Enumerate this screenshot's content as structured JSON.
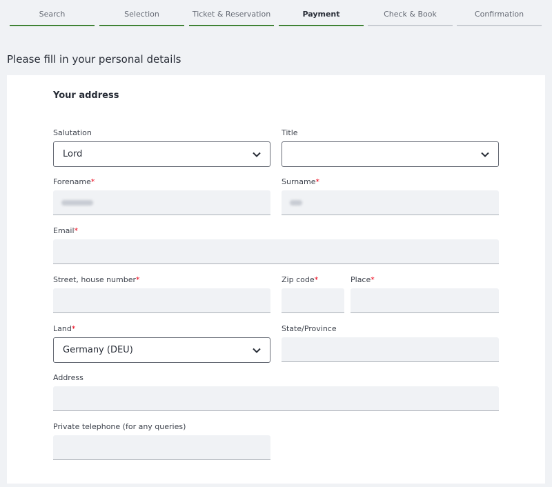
{
  "steps": [
    {
      "label": "Search",
      "state": "done"
    },
    {
      "label": "Selection",
      "state": "done"
    },
    {
      "label": "Ticket & Reservation",
      "state": "done"
    },
    {
      "label": "Payment",
      "state": "active"
    },
    {
      "label": "Check & Book",
      "state": "pending"
    },
    {
      "label": "Confirmation",
      "state": "pending"
    }
  ],
  "page_heading": "Please fill in your personal details",
  "section_title": "Your address",
  "required_marker": "*",
  "fields": {
    "salutation": {
      "label": "Salutation",
      "value": "Lord"
    },
    "title": {
      "label": "Title",
      "value": ""
    },
    "forename": {
      "label": "Forename",
      "required": true
    },
    "surname": {
      "label": "Surname",
      "required": true
    },
    "email": {
      "label": "Email",
      "required": true,
      "value": ""
    },
    "street": {
      "label": "Street, house number",
      "required": true,
      "value": ""
    },
    "zip": {
      "label": "Zip code",
      "required": true,
      "value": ""
    },
    "place": {
      "label": "Place",
      "required": true,
      "value": ""
    },
    "land": {
      "label": "Land",
      "required": true,
      "value": "Germany (DEU)"
    },
    "state": {
      "label": "State/Province",
      "value": ""
    },
    "address": {
      "label": "Address",
      "value": ""
    },
    "phone": {
      "label": "Private telephone (for any queries)",
      "value": ""
    }
  },
  "colors": {
    "accent": "#408335",
    "required": "#ec0016",
    "field_bg": "#f0f2f5"
  },
  "icons": {
    "dropdown": "chevron-down-icon"
  }
}
